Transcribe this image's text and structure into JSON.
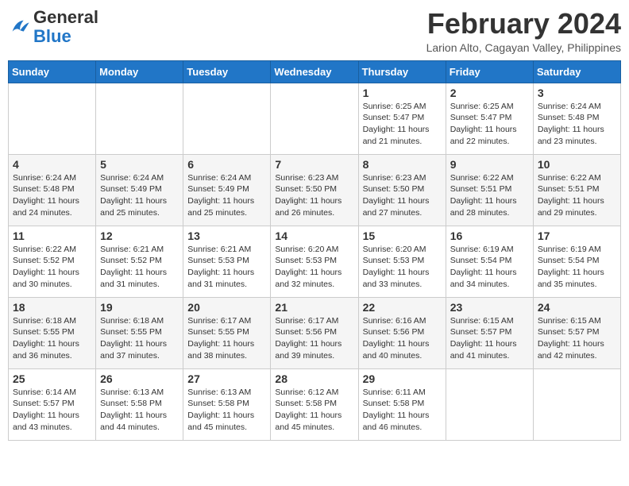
{
  "logo": {
    "general": "General",
    "blue": "Blue"
  },
  "title": "February 2024",
  "subtitle": "Larion Alto, Cagayan Valley, Philippines",
  "days_of_week": [
    "Sunday",
    "Monday",
    "Tuesday",
    "Wednesday",
    "Thursday",
    "Friday",
    "Saturday"
  ],
  "weeks": [
    [
      {
        "day": "",
        "info": ""
      },
      {
        "day": "",
        "info": ""
      },
      {
        "day": "",
        "info": ""
      },
      {
        "day": "",
        "info": ""
      },
      {
        "day": "1",
        "sunrise": "6:25 AM",
        "sunset": "5:47 PM",
        "daylight": "11 hours and 21 minutes."
      },
      {
        "day": "2",
        "sunrise": "6:25 AM",
        "sunset": "5:47 PM",
        "daylight": "11 hours and 22 minutes."
      },
      {
        "day": "3",
        "sunrise": "6:24 AM",
        "sunset": "5:48 PM",
        "daylight": "11 hours and 23 minutes."
      }
    ],
    [
      {
        "day": "4",
        "sunrise": "6:24 AM",
        "sunset": "5:48 PM",
        "daylight": "11 hours and 24 minutes."
      },
      {
        "day": "5",
        "sunrise": "6:24 AM",
        "sunset": "5:49 PM",
        "daylight": "11 hours and 25 minutes."
      },
      {
        "day": "6",
        "sunrise": "6:24 AM",
        "sunset": "5:49 PM",
        "daylight": "11 hours and 25 minutes."
      },
      {
        "day": "7",
        "sunrise": "6:23 AM",
        "sunset": "5:50 PM",
        "daylight": "11 hours and 26 minutes."
      },
      {
        "day": "8",
        "sunrise": "6:23 AM",
        "sunset": "5:50 PM",
        "daylight": "11 hours and 27 minutes."
      },
      {
        "day": "9",
        "sunrise": "6:22 AM",
        "sunset": "5:51 PM",
        "daylight": "11 hours and 28 minutes."
      },
      {
        "day": "10",
        "sunrise": "6:22 AM",
        "sunset": "5:51 PM",
        "daylight": "11 hours and 29 minutes."
      }
    ],
    [
      {
        "day": "11",
        "sunrise": "6:22 AM",
        "sunset": "5:52 PM",
        "daylight": "11 hours and 30 minutes."
      },
      {
        "day": "12",
        "sunrise": "6:21 AM",
        "sunset": "5:52 PM",
        "daylight": "11 hours and 31 minutes."
      },
      {
        "day": "13",
        "sunrise": "6:21 AM",
        "sunset": "5:53 PM",
        "daylight": "11 hours and 31 minutes."
      },
      {
        "day": "14",
        "sunrise": "6:20 AM",
        "sunset": "5:53 PM",
        "daylight": "11 hours and 32 minutes."
      },
      {
        "day": "15",
        "sunrise": "6:20 AM",
        "sunset": "5:53 PM",
        "daylight": "11 hours and 33 minutes."
      },
      {
        "day": "16",
        "sunrise": "6:19 AM",
        "sunset": "5:54 PM",
        "daylight": "11 hours and 34 minutes."
      },
      {
        "day": "17",
        "sunrise": "6:19 AM",
        "sunset": "5:54 PM",
        "daylight": "11 hours and 35 minutes."
      }
    ],
    [
      {
        "day": "18",
        "sunrise": "6:18 AM",
        "sunset": "5:55 PM",
        "daylight": "11 hours and 36 minutes."
      },
      {
        "day": "19",
        "sunrise": "6:18 AM",
        "sunset": "5:55 PM",
        "daylight": "11 hours and 37 minutes."
      },
      {
        "day": "20",
        "sunrise": "6:17 AM",
        "sunset": "5:55 PM",
        "daylight": "11 hours and 38 minutes."
      },
      {
        "day": "21",
        "sunrise": "6:17 AM",
        "sunset": "5:56 PM",
        "daylight": "11 hours and 39 minutes."
      },
      {
        "day": "22",
        "sunrise": "6:16 AM",
        "sunset": "5:56 PM",
        "daylight": "11 hours and 40 minutes."
      },
      {
        "day": "23",
        "sunrise": "6:15 AM",
        "sunset": "5:57 PM",
        "daylight": "11 hours and 41 minutes."
      },
      {
        "day": "24",
        "sunrise": "6:15 AM",
        "sunset": "5:57 PM",
        "daylight": "11 hours and 42 minutes."
      }
    ],
    [
      {
        "day": "25",
        "sunrise": "6:14 AM",
        "sunset": "5:57 PM",
        "daylight": "11 hours and 43 minutes."
      },
      {
        "day": "26",
        "sunrise": "6:13 AM",
        "sunset": "5:58 PM",
        "daylight": "11 hours and 44 minutes."
      },
      {
        "day": "27",
        "sunrise": "6:13 AM",
        "sunset": "5:58 PM",
        "daylight": "11 hours and 45 minutes."
      },
      {
        "day": "28",
        "sunrise": "6:12 AM",
        "sunset": "5:58 PM",
        "daylight": "11 hours and 45 minutes."
      },
      {
        "day": "29",
        "sunrise": "6:11 AM",
        "sunset": "5:58 PM",
        "daylight": "11 hours and 46 minutes."
      },
      {
        "day": "",
        "info": ""
      },
      {
        "day": "",
        "info": ""
      }
    ]
  ],
  "labels": {
    "sunrise_prefix": "Sunrise: ",
    "sunset_prefix": "Sunset: ",
    "daylight_prefix": "Daylight: "
  }
}
